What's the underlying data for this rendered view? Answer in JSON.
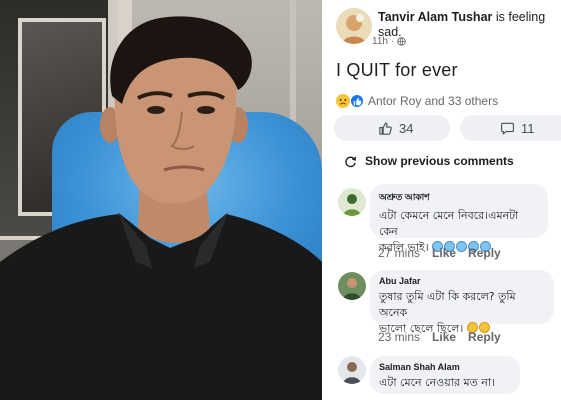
{
  "post": {
    "author": "Tanvir Alam Tushar",
    "feeling": " is feeling sad.",
    "time": "11h",
    "text": "I QUIT for ever",
    "reactions_text": "Antor Roy and 33 others",
    "like_count": "34",
    "comment_count": "11"
  },
  "comments_section": {
    "show_previous": "Show previous comments",
    "comments": [
      {
        "name": "অশ্রুত আকাশ",
        "text_line1": "এটা কেমনে মেনে নিবরে।এমনটা কেন",
        "text_line2": "করলি ভাই।",
        "time": "27 mins",
        "like": "Like",
        "reply": "Reply"
      },
      {
        "name": "Abu Jafar",
        "text_line1": "তুষার তুমি এটা কি করলে? তুমি অনেক",
        "text_line2": "ভালো ছেলে ছিলে।",
        "time": "23 mins",
        "like": "Like",
        "reply": "Reply"
      },
      {
        "name": "Salman Shah Alam",
        "text_line1": "এটা মেনে নেওয়ার মত না।"
      }
    ]
  },
  "colors": {
    "accent": "#1877f2",
    "seat": "#3d93d6",
    "bubble": "#f0f2f5"
  }
}
